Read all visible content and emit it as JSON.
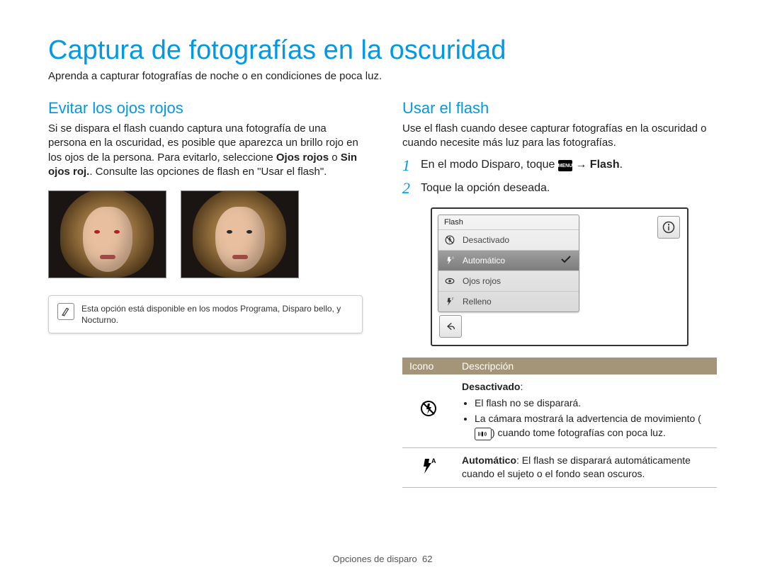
{
  "title": "Captura de fotografías en la oscuridad",
  "subtitle": "Aprenda a capturar fotografías de noche o en condiciones de poca luz.",
  "left": {
    "heading": "Evitar los ojos rojos",
    "para_pre": "Si se dispara el flash cuando captura una fotografía de una persona en la oscuridad, es posible que aparezca un brillo rojo en los ojos de la persona. Para evitarlo, seleccione ",
    "bold1": "Ojos rojos",
    "mid1": " o ",
    "bold2": "Sin ojos roj.",
    "para_post": ". Consulte las opciones de flash en \"Usar el flash\".",
    "note": "Esta opción está disponible en los modos Programa, Disparo bello, y Nocturno."
  },
  "right": {
    "heading": "Usar el flash",
    "para": "Use el flash cuando desee capturar fotografías en la oscuridad o cuando necesite más luz para las fotografías.",
    "step1_pre": "En el modo Disparo, toque ",
    "menu_label": "MENU",
    "step1_mid": " → ",
    "step1_bold": "Flash",
    "step1_post": ".",
    "step2": "Toque la opción deseada.",
    "screen": {
      "header": "Flash",
      "options": [
        "Desactivado",
        "Automático",
        "Ojos rojos",
        "Relleno"
      ],
      "selected_index": 1
    },
    "table": {
      "th_icon": "Icono",
      "th_desc": "Descripción",
      "row1": {
        "title": "Desactivado",
        "colon": ":",
        "b1": "El flash no se disparará.",
        "b2a": "La cámara mostrará la advertencia de movimiento (",
        "b2b": ") cuando tome fotografías con poca luz."
      },
      "row2": {
        "title": "Automático",
        "rest": ": El flash se disparará automáticamente cuando el sujeto o el fondo sean oscuros."
      }
    }
  },
  "footer_section": "Opciones de disparo",
  "footer_page": "62"
}
